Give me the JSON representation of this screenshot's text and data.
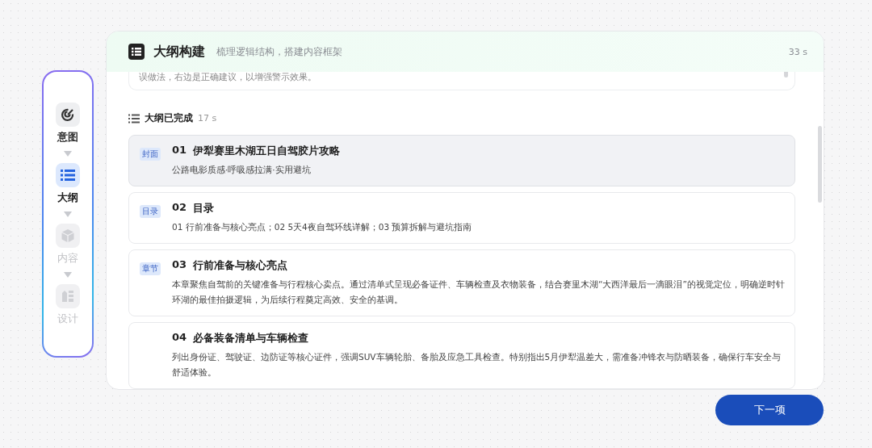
{
  "steps": [
    {
      "label": "意图",
      "selected": false,
      "disabled": false
    },
    {
      "label": "大纲",
      "selected": true,
      "disabled": false
    },
    {
      "label": "内容",
      "selected": false,
      "disabled": true
    },
    {
      "label": "设计",
      "selected": false,
      "disabled": true
    }
  ],
  "panel": {
    "title": "大纲构建",
    "subtitle": "梳理逻辑结构，搭建内容框架",
    "time": "33 s",
    "prompt_tail": "误做法，右边是正确建议，以增强警示效果。",
    "status": {
      "label": "大纲已完成",
      "time": "17 s"
    },
    "items": [
      {
        "tag": "封面",
        "number": "01",
        "title": "伊犁赛里木湖五日自驾胶片攻略",
        "desc": "公路电影质感·呼吸感拉满·实用避坑",
        "selected": true
      },
      {
        "tag": "目录",
        "number": "02",
        "title": "目录",
        "desc": "01 行前准备与核心亮点；02 5天4夜自驾环线详解；03 预算拆解与避坑指南",
        "selected": false
      },
      {
        "tag": "章节",
        "number": "03",
        "title": "行前准备与核心亮点",
        "desc": "本章聚焦自驾前的关键准备与行程核心卖点。通过清单式呈现必备证件、车辆检查及衣物装备，结合赛里木湖“大西洋最后一滴眼泪”的视觉定位，明确逆时针环湖的最佳拍摄逻辑，为后续行程奠定高效、安全的基调。",
        "selected": false
      },
      {
        "number": "04",
        "title": "必备装备清单与车辆检查",
        "desc": "列出身份证、驾驶证、边防证等核心证件，强调SUV车辆轮胎、备胎及应急工具检查。特别指出5月伊犁温差大，需准备冲锋衣与防晒装备，确保行车安全与舒适体验。",
        "selected": false
      }
    ]
  },
  "next_button": "下一项"
}
